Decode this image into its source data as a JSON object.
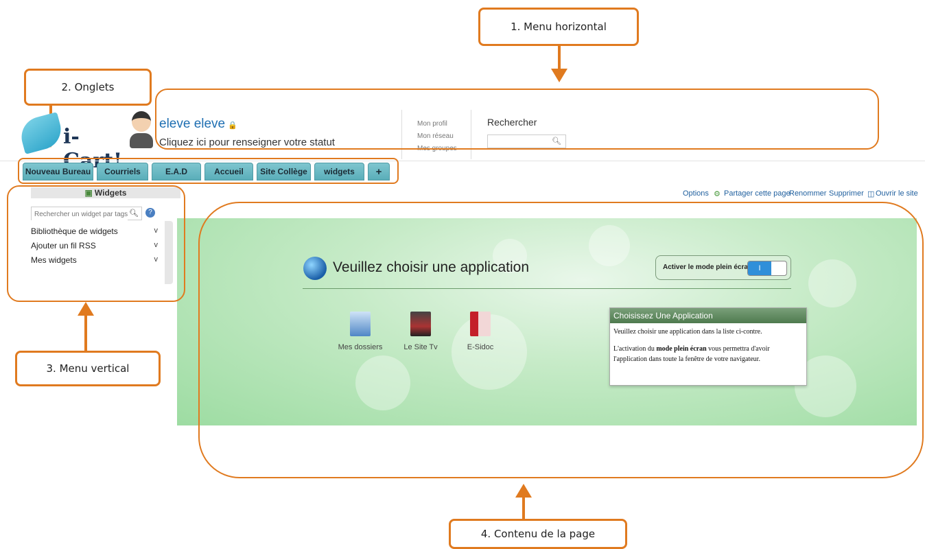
{
  "callouts": {
    "menu_horizontal": "1. Menu horizontal",
    "onglets": "2. Onglets",
    "menu_vertical": "3. Menu vertical",
    "contenu": "4. Contenu de la page"
  },
  "header": {
    "logo_text": "i-Cart!",
    "user_name": "eleve eleve",
    "user_status": "Cliquez ici pour renseigner votre statut",
    "profile_links": [
      "Mon profil",
      "Mon réseau",
      "Mes groupes"
    ],
    "search_label": "Rechercher"
  },
  "tabs": [
    "Nouveau Bureau",
    "Courriels",
    "E.A.D",
    "Accueil",
    "Site Collège",
    "widgets",
    "+"
  ],
  "sidebar": {
    "title": "Widgets",
    "search_placeholder": "Rechercher un widget par tags",
    "items": [
      {
        "label": "Bibliothèque de widgets",
        "chevron": "v"
      },
      {
        "label": "Ajouter un fil RSS",
        "chevron": "v"
      },
      {
        "label": "Mes widgets",
        "chevron": "v"
      }
    ]
  },
  "page_actions": [
    "Options",
    "Partager cette page",
    "Renommer",
    "Supprimer",
    "Ouvrir le site"
  ],
  "content": {
    "title": "Veuillez choisir une application",
    "fullscreen_label": "Activer le mode plein écran",
    "toggle_value": "I",
    "apps": [
      "Mes dossiers",
      "Le Site Tv",
      "E-Sidoc"
    ],
    "help_title": "Choisissez Une Application",
    "help_line1": "Veuillez choisir une application dans la liste ci-contre.",
    "help_line2_pre": "L'activation du ",
    "help_line2_bold": "mode plein écran",
    "help_line2_post": " vous permettra d'avoir l'application dans toute la fenêtre de votre navigateur."
  },
  "colors": {
    "accent": "#e07a1f",
    "tab": "#6bb8c2",
    "link": "#1f6fb2",
    "content_bg": "#9ddca2"
  }
}
